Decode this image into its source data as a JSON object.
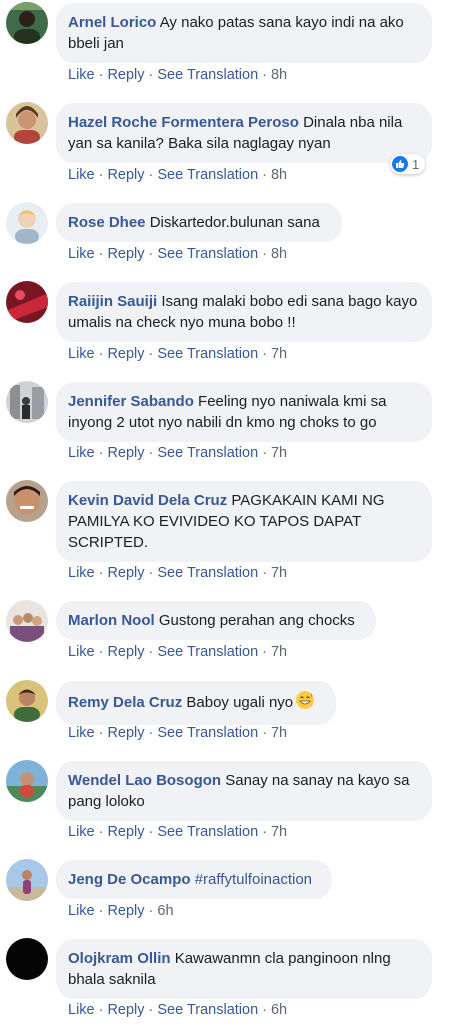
{
  "actions": {
    "like": "Like",
    "reply": "Reply",
    "translate": "See Translation",
    "sep": "·"
  },
  "reaction": {
    "icon": "thumbs-up-icon",
    "count": "1"
  },
  "comments": [
    {
      "author": "Arnel Lorico",
      "text": "Ay nako patas sana kayo indi na ako bbeli jan",
      "time": "8h"
    },
    {
      "author": "Hazel Roche Formentera Peroso",
      "text": "Dinala nba nila yan sa kanila? Baka sila naglagay nyan",
      "time": "8h"
    },
    {
      "author": "Rose Dhee",
      "text": "Diskartedor.bulunan sana",
      "time": "8h"
    },
    {
      "author": "Raiijin Sauiji",
      "text": "Isang malaki bobo edi sana bago kayo umalis na check nyo muna bobo !!",
      "time": "7h"
    },
    {
      "author": "Jennifer Sabando",
      "text": "Feeling nyo naniwala kmi sa inyong 2 utot nyo nabili dn kmo ng choks to go",
      "time": "7h"
    },
    {
      "author": "Kevin David Dela Cruz",
      "text": "PAGKAKAIN KAMI NG PAMILYA KO EVIVIDEO KO TAPOS DAPAT SCRIPTED.",
      "time": "7h"
    },
    {
      "author": "Marlon Nool",
      "text": "Gustong perahan ang chocks",
      "time": "7h"
    },
    {
      "author": "Remy Dela Cruz",
      "text": "Baboy ugali nyo",
      "emoji": "grinning-sweat-emoji-icon",
      "time": "7h"
    },
    {
      "author": "Wendel Lao Bosogon",
      "text": "Sanay na sanay na kayo sa pang loloko",
      "time": "7h"
    },
    {
      "author": "Jeng De Ocampo",
      "text": "#raffytulfoinaction",
      "time": "6h"
    },
    {
      "author": "Olojkram Ollin",
      "text": "Kawawanmn cla panginoon nlng bhala saknila",
      "time": "6h"
    }
  ]
}
